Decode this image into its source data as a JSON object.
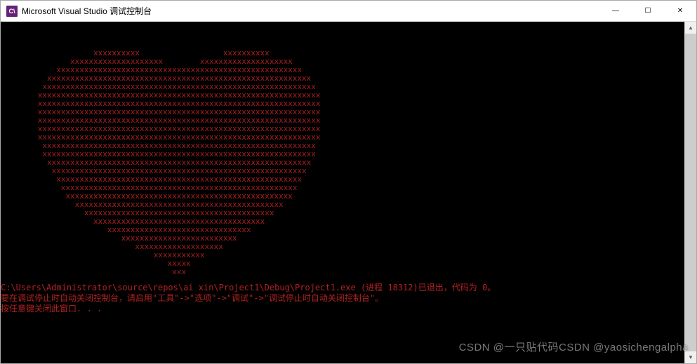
{
  "titlebar": {
    "icon_text": "C\\",
    "title": "Microsoft Visual Studio 调试控制台",
    "minimize": "—",
    "maximize": "☐",
    "close": "✕"
  },
  "ascii_art": "                    xxxxxxxxxx                  xxxxxxxxxx\n               xxxxxxxxxxxxxxxxxxxx        xxxxxxxxxxxxxxxxxxxx\n            xxxxxxxxxxxxxxxxxxxxxxxxxxxxxxxxxxxxxxxxxxxxxxxxxxxxx\n          xxxxxxxxxxxxxxxxxxxxxxxxxxxxxxxxxxxxxxxxxxxxxxxxxxxxxxxxx\n         xxxxxxxxxxxxxxxxxxxxxxxxxxxxxxxxxxxxxxxxxxxxxxxxxxxxxxxxxxx\n        xxxxxxxxxxxxxxxxxxxxxxxxxxxxxxxxxxxxxxxxxxxxxxxxxxxxxxxxxxxxx\n        xxxxxxxxxxxxxxxxxxxxxxxxxxxxxxxxxxxxxxxxxxxxxxxxxxxxxxxxxxxxx\n        xxxxxxxxxxxxxxxxxxxxxxxxxxxxxxxxxxxxxxxxxxxxxxxxxxxxxxxxxxxxx\n        xxxxxxxxxxxxxxxxxxxxxxxxxxxxxxxxxxxxxxxxxxxxxxxxxxxxxxxxxxxxx\n        xxxxxxxxxxxxxxxxxxxxxxxxxxxxxxxxxxxxxxxxxxxxxxxxxxxxxxxxxxxxx\n        xxxxxxxxxxxxxxxxxxxxxxxxxxxxxxxxxxxxxxxxxxxxxxxxxxxxxxxxxxxxx\n         xxxxxxxxxxxxxxxxxxxxxxxxxxxxxxxxxxxxxxxxxxxxxxxxxxxxxxxxxxx\n         xxxxxxxxxxxxxxxxxxxxxxxxxxxxxxxxxxxxxxxxxxxxxxxxxxxxxxxxxxx\n          xxxxxxxxxxxxxxxxxxxxxxxxxxxxxxxxxxxxxxxxxxxxxxxxxxxxxxxxx\n           xxxxxxxxxxxxxxxxxxxxxxxxxxxxxxxxxxxxxxxxxxxxxxxxxxxxxxx\n            xxxxxxxxxxxxxxxxxxxxxxxxxxxxxxxxxxxxxxxxxxxxxxxxxxxxx\n             xxxxxxxxxxxxxxxxxxxxxxxxxxxxxxxxxxxxxxxxxxxxxxxxxxx\n              xxxxxxxxxxxxxxxxxxxxxxxxxxxxxxxxxxxxxxxxxxxxxxxxx\n                xxxxxxxxxxxxxxxxxxxxxxxxxxxxxxxxxxxxxxxxxxxxx\n                  xxxxxxxxxxxxxxxxxxxxxxxxxxxxxxxxxxxxxxxxx\n                    xxxxxxxxxxxxxxxxxxxxxxxxxxxxxxxxxxxxx\n                       xxxxxxxxxxxxxxxxxxxxxxxxxxxxxxx\n                          xxxxxxxxxxxxxxxxxxxxxxxxx\n                             xxxxxxxxxxxxxxxxxxx\n                                 xxxxxxxxxxx\n                                    xxxxx\n                                     xxx",
  "console_messages": "C:\\Users\\Administrator\\source\\repos\\ai xin\\Project1\\Debug\\Project1.exe (进程 18312)已退出，代码为 0。\n要在调试停止时自动关闭控制台，请启用\"工具\"->\"选项\"->\"调试\"->\"调试停止时自动关闭控制台\"。\n按任意键关闭此窗口. . .",
  "scrollbar": {
    "up": "▲",
    "down": "▼"
  },
  "watermark": {
    "main": "CSDN @一只贴代码CSDN @yaosichengalpha"
  }
}
